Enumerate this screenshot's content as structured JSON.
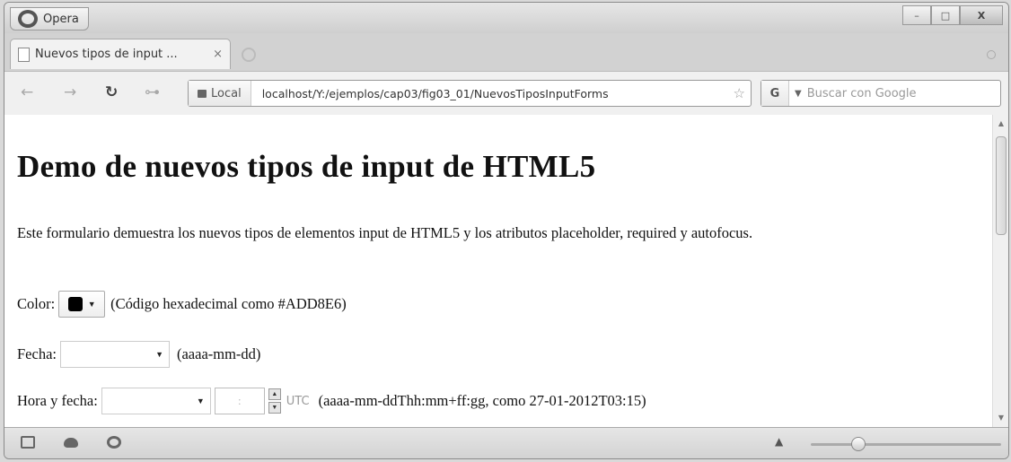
{
  "window": {
    "app_button_label": "Opera",
    "controls": {
      "minimize": "–",
      "maximize": "□",
      "close": "X"
    }
  },
  "tab": {
    "title": "Nuevos tipos de input ...",
    "close": "×"
  },
  "toolbar": {
    "back": "←",
    "forward": "→",
    "reload": "↻",
    "key": "⊶",
    "security_badge": "Local",
    "url": "localhost/Y:/ejemplos/cap03/fig03_01/NuevosTiposInputForms",
    "star": "☆",
    "search_engine_icon": "G",
    "search_caret": "▼",
    "search_placeholder": "Buscar con Google"
  },
  "page": {
    "heading": "Demo de nuevos tipos de input de HTML5",
    "intro": "Este formulario demuestra los nuevos tipos de elementos input de HTML5 y los atributos placeholder, required y autofocus.",
    "color_field": {
      "label": "Color:",
      "value": "#000000",
      "hint": "(Código hexadecimal como #ADD8E6)"
    },
    "date_field": {
      "label": "Fecha:",
      "hint": "(aaaa-mm-dd)"
    },
    "datetime_field": {
      "label": "Hora y fecha:",
      "time_placeholder": ":",
      "utc_label": "UTC",
      "hint": "(aaaa-mm-ddThh:mm+ff:gg, como 27-01-2012T03:15)"
    },
    "dropdown_arrow": "▼",
    "spin_up": "▲",
    "spin_down": "▼"
  },
  "statusbar": {
    "zoom_out": "▲",
    "zoom_level": 0.25
  },
  "scrollbar": {
    "up": "▲",
    "down": "▼"
  }
}
